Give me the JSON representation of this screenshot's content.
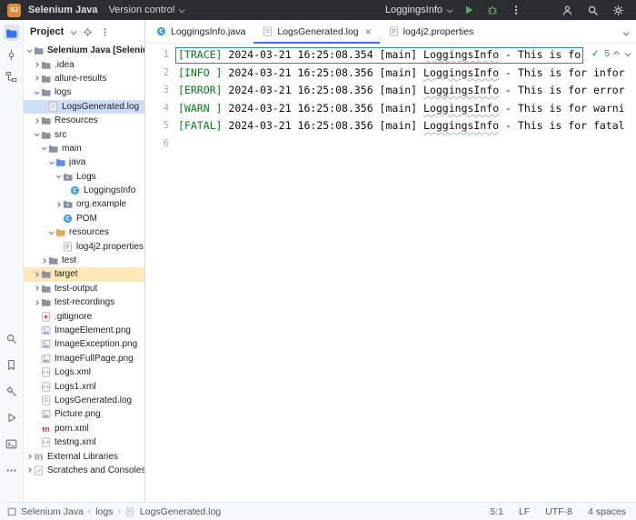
{
  "colors": {
    "accent": "#3574f0",
    "titlebar_bg": "#2b2d30",
    "badge_bg": "#e08a3c",
    "run_green": "#59a869",
    "log_green": "#067d17",
    "selection_bg": "#cfdffa",
    "excluded_bg": "#ffe7b8",
    "panel_bg": "#f7f8fa"
  },
  "titlebar": {
    "app_badge": "SJ",
    "project_name": "Selenium Java",
    "vcs_widget": "Version control",
    "run_config": "LoggingsInfo",
    "icons": [
      "run-icon",
      "debug-icon",
      "more-vertical-icon",
      "user-icon",
      "search-icon",
      "settings-icon"
    ]
  },
  "stripe": {
    "top": [
      {
        "name": "project-folder-icon",
        "active": true
      },
      {
        "name": "commit-icon"
      },
      {
        "name": "structure-icon"
      }
    ],
    "bottom": [
      {
        "name": "find-icon"
      },
      {
        "name": "bookmarks-icon"
      },
      {
        "name": "build-icon"
      },
      {
        "name": "run-tool-icon"
      },
      {
        "name": "terminal-icon"
      },
      {
        "name": "more-tool-windows-icon"
      }
    ]
  },
  "project_panel": {
    "title": "Project",
    "tree": [
      {
        "label": "Selenium Java [SeleniumJava]",
        "level": 0,
        "expanded": true,
        "icon": "folder-icon",
        "bold": true
      },
      {
        "label": ".idea",
        "level": 1,
        "expanded": false,
        "icon": "folder-icon"
      },
      {
        "label": "allure-results",
        "level": 1,
        "expanded": false,
        "icon": "folder-icon"
      },
      {
        "label": "logs",
        "level": 1,
        "expanded": true,
        "icon": "folder-icon"
      },
      {
        "label": "LogsGenerated.log",
        "level": 2,
        "expanded": null,
        "icon": "file-icon",
        "selected": true
      },
      {
        "label": "Resources",
        "level": 1,
        "expanded": false,
        "icon": "folder-icon"
      },
      {
        "label": "src",
        "level": 1,
        "expanded": true,
        "icon": "folder-icon"
      },
      {
        "label": "main",
        "level": 2,
        "expanded": true,
        "icon": "folder-icon"
      },
      {
        "label": "java",
        "level": 3,
        "expanded": true,
        "icon": "source-folder-icon"
      },
      {
        "label": "Logs",
        "level": 4,
        "expanded": true,
        "icon": "package-icon"
      },
      {
        "label": "LoggingsInfo",
        "level": 5,
        "expanded": null,
        "icon": "class-icon"
      },
      {
        "label": "org.example",
        "level": 4,
        "expanded": false,
        "icon": "package-icon"
      },
      {
        "label": "POM",
        "level": 4,
        "expanded": null,
        "icon": "class-icon"
      },
      {
        "label": "resources",
        "level": 3,
        "expanded": true,
        "icon": "resources-folder-icon"
      },
      {
        "label": "log4j2.properties",
        "level": 4,
        "expanded": null,
        "icon": "properties-icon"
      },
      {
        "label": "test",
        "level": 2,
        "expanded": false,
        "icon": "folder-icon"
      },
      {
        "label": "target",
        "level": 1,
        "expanded": false,
        "icon": "folder-icon",
        "highlight": "excluded"
      },
      {
        "label": "test-output",
        "level": 1,
        "expanded": false,
        "icon": "folder-icon"
      },
      {
        "label": "test-recordings",
        "level": 1,
        "expanded": false,
        "icon": "folder-icon"
      },
      {
        "label": ".gitignore",
        "level": 1,
        "expanded": null,
        "icon": "git-icon"
      },
      {
        "label": "ImageElement.png",
        "level": 1,
        "expanded": null,
        "icon": "image-icon"
      },
      {
        "label": "ImageException.png",
        "level": 1,
        "expanded": null,
        "icon": "image-icon"
      },
      {
        "label": "ImageFullPage.png",
        "level": 1,
        "expanded": null,
        "icon": "image-icon"
      },
      {
        "label": "Logs.xml",
        "level": 1,
        "expanded": null,
        "icon": "xml-icon"
      },
      {
        "label": "Logs1.xml",
        "level": 1,
        "expanded": null,
        "icon": "xml-icon"
      },
      {
        "label": "LogsGenerated.log",
        "level": 1,
        "expanded": null,
        "icon": "file-icon"
      },
      {
        "label": "Picture.png",
        "level": 1,
        "expanded": null,
        "icon": "image-icon"
      },
      {
        "label": "pom.xml",
        "level": 1,
        "expanded": null,
        "icon": "maven-icon"
      },
      {
        "label": "testng.xml",
        "level": 1,
        "expanded": null,
        "icon": "xml-icon"
      },
      {
        "label": "External Libraries",
        "level": 0,
        "expanded": false,
        "icon": "library-icon"
      },
      {
        "label": "Scratches and Consoles",
        "level": 0,
        "expanded": false,
        "icon": "scratches-icon"
      }
    ]
  },
  "editor": {
    "tabs": [
      {
        "label": "LoggingsInfo.java",
        "icon": "class-icon",
        "active": false
      },
      {
        "label": "LogsGenerated.log",
        "icon": "file-icon",
        "active": true,
        "close": "×"
      },
      {
        "label": "log4j2.properties",
        "icon": "properties-icon",
        "active": false
      }
    ],
    "inspections": {
      "check": "✓",
      "count": "5"
    },
    "lines": [
      {
        "num": "1",
        "tag": "[TRACE]",
        "mid": " 2024-03-21 16:25:08.354 [main] ",
        "name": "LoggingsInfo",
        "tail": " - This is fo",
        "boxed": true
      },
      {
        "num": "2",
        "tag": "[INFO ]",
        "mid": " 2024-03-21 16:25:08.356 [main] ",
        "name": "LoggingsInfo",
        "tail": " - This is for infor"
      },
      {
        "num": "3",
        "tag": "[ERROR]",
        "mid": " 2024-03-21 16:25:08.356 [main] ",
        "name": "LoggingsInfo",
        "tail": " - This is for error"
      },
      {
        "num": "4",
        "tag": "[WARN ]",
        "mid": " 2024-03-21 16:25:08.356 [main] ",
        "name": "LoggingsInfo",
        "tail": " - This is for warni"
      },
      {
        "num": "5",
        "tag": "[FATAL]",
        "mid": " 2024-03-21 16:25:08.356 [main] ",
        "name": "LoggingsInfo",
        "tail": " - This is for fatal"
      },
      {
        "num": "6",
        "tag": "",
        "mid": "",
        "name": "",
        "tail": ""
      }
    ]
  },
  "statusbar": {
    "breadcrumbs": [
      {
        "label": "Selenium Java"
      },
      {
        "label": "logs"
      },
      {
        "label": "LogsGenerated.log"
      }
    ],
    "separator": "›",
    "position": "5:1",
    "line_sep": "LF",
    "encoding": "UTF-8",
    "indent": "4 spaces"
  }
}
